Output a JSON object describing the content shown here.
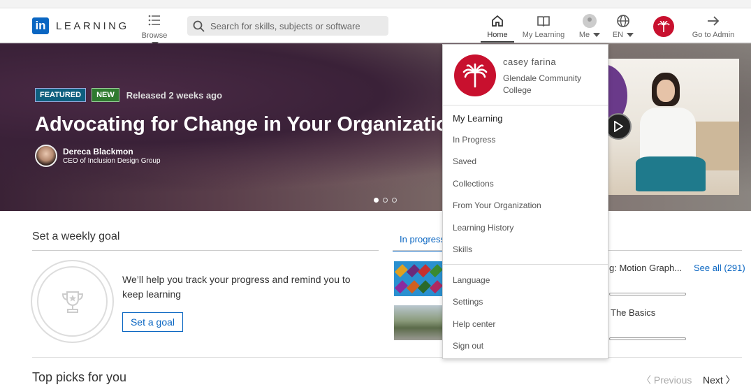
{
  "header": {
    "logo_mark": "in",
    "logo_text": "LEARNING",
    "browse_label": "Browse",
    "search_placeholder": "Search for skills, subjects or software",
    "nav": {
      "home": "Home",
      "my_learning": "My Learning",
      "me": "Me",
      "language": "EN",
      "admin": "Go to Admin"
    }
  },
  "hero": {
    "badge_featured": "FEATURED",
    "badge_new": "NEW",
    "released": "Released 2 weeks ago",
    "title": "Advocating for Change in Your Organization",
    "author_name": "Dereca Blackmon",
    "author_role": "CEO of Inclusion Design Group",
    "carousel_dots": 3,
    "active_dot": 1
  },
  "goal": {
    "title": "Set a weekly goal",
    "description": "We’ll help you track your progress and remind you to keep learning",
    "button": "Set a goal"
  },
  "progress_panel": {
    "tab_label": "In progress",
    "see_all": "See all (291)",
    "courses": [
      {
        "title_fragment": "g: Motion Graph..."
      },
      {
        "title_fragment": "The Basics"
      }
    ]
  },
  "top_picks": {
    "title": "Top picks for you",
    "previous": "Previous",
    "next": "Next"
  },
  "dropdown": {
    "user_name": "casey farina",
    "org_name": "Glendale Community College",
    "items_primary": [
      "My Learning",
      "In Progress",
      "Saved",
      "Collections",
      "From Your Organization",
      "Learning History",
      "Skills"
    ],
    "items_secondary": [
      "Language",
      "Settings",
      "Help center",
      "Sign out"
    ]
  },
  "colors": {
    "brand_blue": "#0a66c2",
    "org_red": "#c8102e",
    "featured_badge": "#0e5f7e",
    "new_badge": "#2f7a2f"
  }
}
